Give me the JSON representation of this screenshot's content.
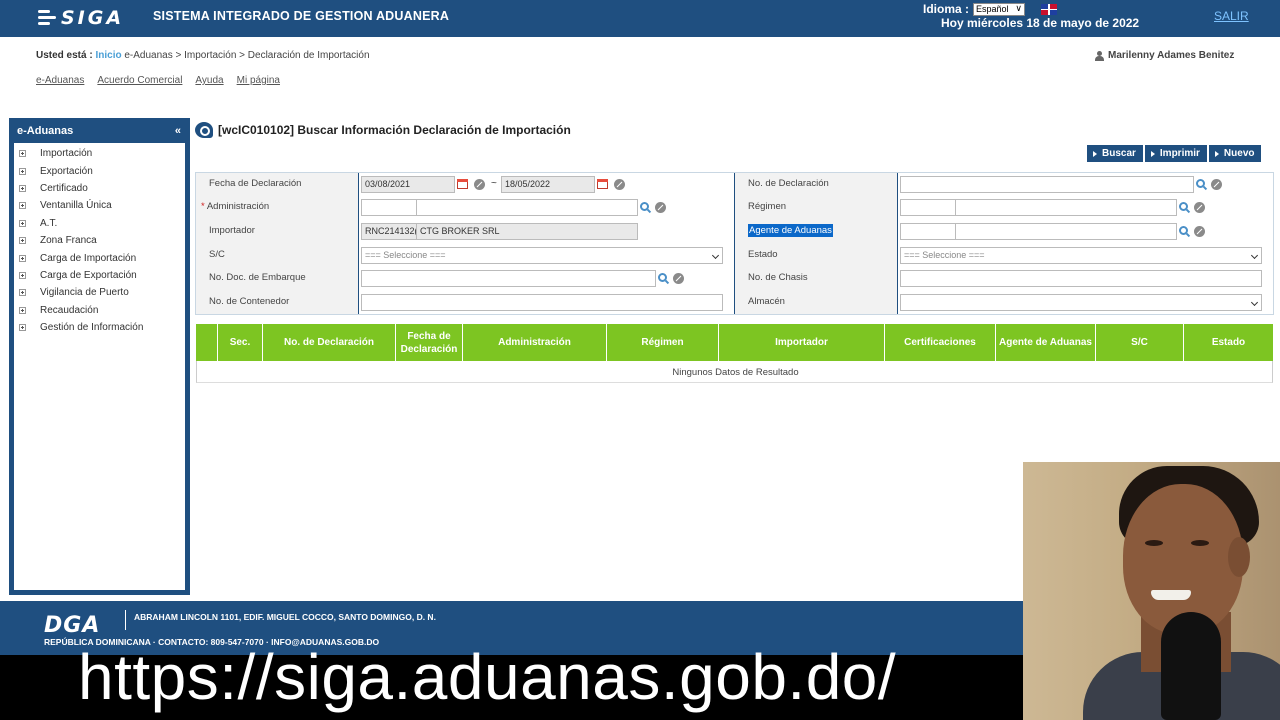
{
  "header": {
    "logo_text": "SIGA",
    "system_title": "SISTEMA INTEGRADO DE GESTION ADUANERA",
    "language_label": "Idioma :",
    "language_value": "Español",
    "date_text": "Hoy miércoles 18 de mayo de 2022",
    "logout_label": "SALIR"
  },
  "breadcrumb": {
    "prefix": "Usted está :",
    "home": "Inicio",
    "path": "e-Aduanas > Importación > Declaración de Importación"
  },
  "user": {
    "name": "Marilenny Adames Benitez"
  },
  "top_nav": [
    "e-Aduanas",
    "Acuerdo Comercial",
    "Ayuda",
    "Mi página"
  ],
  "sidebar": {
    "title": "e-Aduanas",
    "collapse_glyph": "«",
    "items": [
      "Importación",
      "Exportación",
      "Certificado",
      "Ventanilla Única",
      "A.T.",
      "Zona Franca",
      "Carga de Importación",
      "Carga de Exportación",
      "Vigilancia de Puerto",
      "Recaudación",
      "Gestión de Información"
    ]
  },
  "main": {
    "title": "[wcIC010102] Buscar Información Declaración de Importación",
    "buttons": {
      "search": "Buscar",
      "print": "Imprimir",
      "new": "Nuevo"
    }
  },
  "form": {
    "fecha_label": "Fecha de Declaración",
    "fecha_from": "03/08/2021",
    "fecha_sep": "~",
    "fecha_to": "18/05/2022",
    "no_decl_label": "No. de Declaración",
    "admin_required": "*",
    "admin_label": "Administración",
    "regimen_label": "Régimen",
    "importador_label": "Importador",
    "importador_code": "RNC214132(",
    "importador_name": "CTG BROKER SRL",
    "agente_label": "Agente de Aduanas",
    "sc_label": "S/C",
    "sc_value": "=== Seleccione ===",
    "estado_label": "Estado",
    "estado_value": "=== Seleccione ===",
    "embarque_label": "No. Doc. de Embarque",
    "chasis_label": "No. de Chasis",
    "contenedor_label": "No. de Contenedor",
    "almacen_label": "Almacén"
  },
  "grid": {
    "columns": [
      "Sec.",
      "No. de Declaración",
      "Fecha de Declaración",
      "Administración",
      "Régimen",
      "Importador",
      "Certificaciones",
      "Agente de Aduanas",
      "S/C",
      "Estado"
    ],
    "empty_text": "Ningunos Datos de Resultado"
  },
  "footer": {
    "logo": "DGA",
    "address": "ABRAHAM LINCOLN 1101, EDIF. MIGUEL COCCO, SANTO DOMINGO, D. N.",
    "contact": "REPÚBLICA DOMINICANA · CONTACTO: 809-547-7070 · INFO@ADUANAS.GOB.DO"
  },
  "caption": "https://siga.aduanas.gob.do/",
  "colors": {
    "brand_blue": "#1f4f80",
    "grid_green": "#7dc522",
    "highlight": "#0b68c9"
  }
}
